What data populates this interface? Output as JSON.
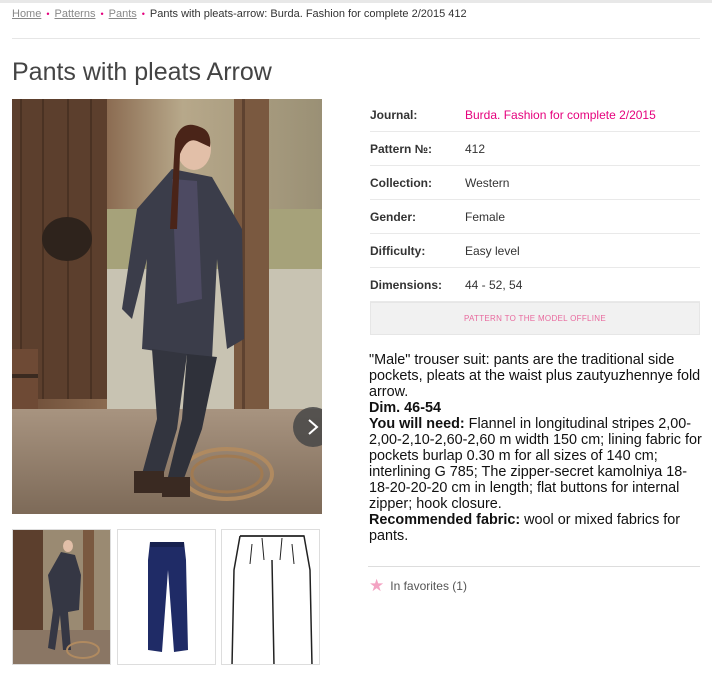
{
  "breadcrumb": {
    "home": "Home",
    "patterns": "Patterns",
    "pants": "Pants",
    "current": "Pants with pleats-arrow: Burda. Fashion for complete 2/2015 412",
    "separator": "•"
  },
  "page": {
    "title": "Pants with pleats Arrow"
  },
  "info": {
    "journal_label": "Journal:",
    "journal_value": "Burda. Fashion for complete 2/2015",
    "pattern_label": "Pattern №:",
    "pattern_value": "412",
    "collection_label": "Collection:",
    "collection_value": "Western",
    "gender_label": "Gender:",
    "gender_value": "Female",
    "difficulty_label": "Difficulty:",
    "difficulty_value": "Easy level",
    "dimensions_label": "Dimensions:",
    "dimensions_value": "44 - 52, 54"
  },
  "offline_button": "PATTERN TO THE MODEL OFFLINE",
  "description": {
    "intro": "\"Male\" trouser suit: pants are the traditional side pockets, pleats at the waist plus zautyuzhennye fold arrow.",
    "dim": "Dim. 46-54",
    "need_label": "You will need:",
    "need_text": " Flannel in longitudinal stripes 2,00-2,00-2,10-2,60-2,60 m width 150 cm; lining fabric for pockets burlap 0.30 m for all sizes of 140 cm; interlining G 785; The zipper-secret kamolniya 18-18-20-20-20 cm in length; flat buttons for internal zipper; hook closure.",
    "fabric_label": "Recommended fabric:",
    "fabric_text": " wool or mixed fabrics for pants."
  },
  "favorites": {
    "label": "In favorites (1)",
    "icon": "star-icon"
  },
  "colors": {
    "accent": "#e5007d",
    "star": "#f3a3c3"
  }
}
